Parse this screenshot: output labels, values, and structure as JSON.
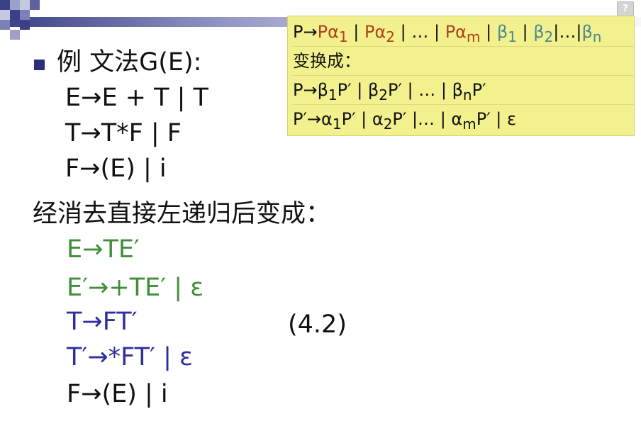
{
  "rule_box": {
    "line1": {
      "lhs": "P→",
      "a1": "Pα",
      "a1_sub": "1",
      "sep1": " | ",
      "a2": "Pα",
      "a2_sub": "2",
      "sep2": " | … | ",
      "am": "Pα",
      "am_sub": "m",
      "sep3": " | ",
      "b1": "β",
      "b1_sub": "1",
      "sep4": " | ",
      "b2": "β",
      "b2_sub": "2",
      "sep5": "|…|",
      "bn": "β",
      "bn_sub": "n"
    },
    "line2": "变换成：",
    "line3": {
      "p1": "P→β",
      "s1": "1",
      "p2": "P′ | β",
      "s2": "2",
      "p3": "P′ | … | β",
      "s3": "n",
      "p4": "P′"
    },
    "line4": {
      "p1": "P′→α",
      "s1": "1",
      "p2": "P′ | α",
      "s2": "2",
      "p3": "P′ |… | α",
      "s3": "m",
      "p4": "P′ | ε"
    }
  },
  "example": {
    "heading": "例  文法G(E):",
    "rules": [
      "E→E + T | T",
      "T→T*F | F",
      "F→(E) | i"
    ]
  },
  "after_text": "经消去直接左递归后变成：",
  "result": {
    "rules": [
      "E→TE′",
      "E′→+TE′ | ε",
      "T→FT′",
      "T′→*FT′ | ε",
      "F→(E) | i"
    ],
    "equation_number": "(4.2)"
  },
  "colors": {
    "green": "#3f8f3a",
    "blue": "#2f2f9e",
    "red": "#b0401e",
    "teal": "#4a8a92",
    "box_yellow": "#f3f08e"
  },
  "help_icon": "question-mark-icon",
  "help_label": "?"
}
